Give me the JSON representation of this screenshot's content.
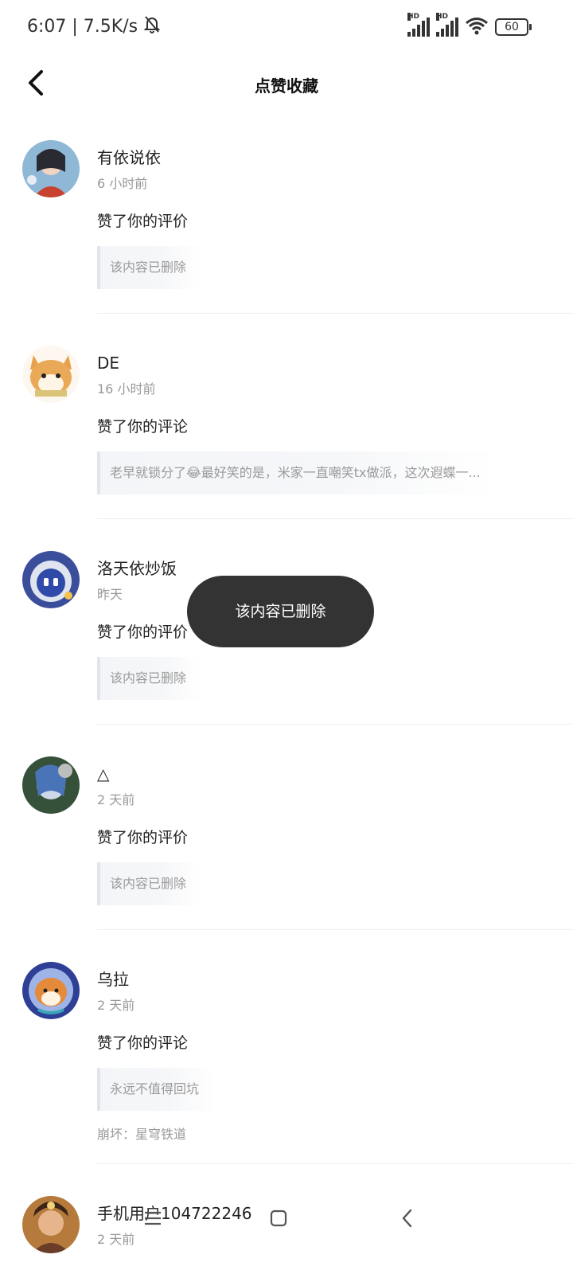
{
  "status_bar": {
    "time_speed": "6:07 | 7.5K/s",
    "signal1": "HD",
    "signal2": "HD",
    "battery": "60"
  },
  "header": {
    "title": "点赞收藏"
  },
  "items": [
    {
      "name": "有依说依",
      "time": "6 小时前",
      "action": "赞了你的评价",
      "quote": "该内容已删除",
      "source": ""
    },
    {
      "name": "DE",
      "time": "16 小时前",
      "action": "赞了你的评论",
      "quote": "老早就锁分了😂最好笑的是，米家一直嘲笑tx做派，这次遐蝶一...",
      "source": ""
    },
    {
      "name": "洛天依炒饭",
      "time": "昨天",
      "action": "赞了你的评价",
      "quote": "该内容已删除",
      "source": ""
    },
    {
      "name": "△",
      "time": "2 天前",
      "action": "赞了你的评价",
      "quote": "该内容已删除",
      "source": ""
    },
    {
      "name": "乌拉",
      "time": "2 天前",
      "action": "赞了你的评论",
      "quote": "永远不值得回坑",
      "source": "崩坏：星穹铁道"
    },
    {
      "name": "手机用户104722246",
      "time": "2 天前",
      "action": "",
      "quote": "",
      "source": ""
    }
  ],
  "toast": {
    "text": "该内容已删除"
  },
  "icons": {
    "back": "back-arrow-icon",
    "mute": "bell-off-icon",
    "wifi": "wifi-icon",
    "menu": "menu-icon",
    "home": "home-square-icon",
    "nav_back": "nav-back-icon"
  }
}
